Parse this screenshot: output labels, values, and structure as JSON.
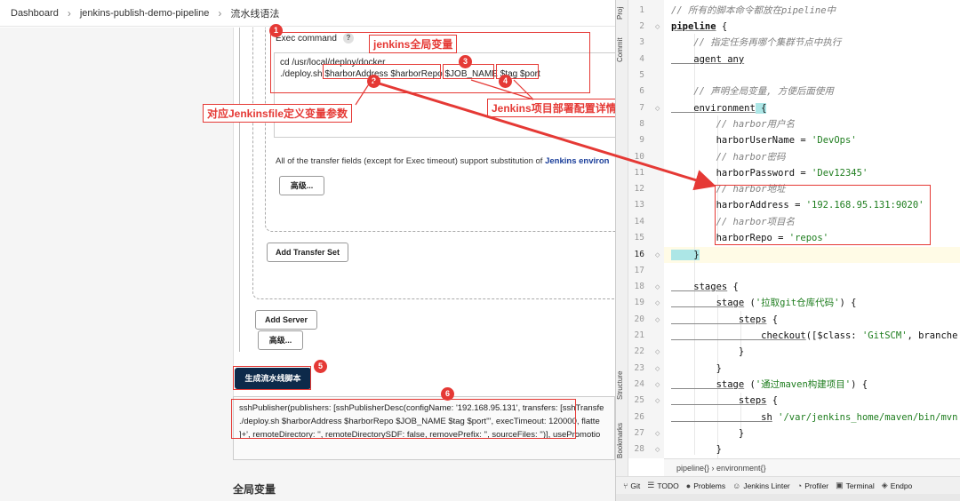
{
  "breadcrumb": [
    "Dashboard",
    "jenkins-publish-demo-pipeline",
    "流水线语法"
  ],
  "exec_label": "Exec command",
  "help_icon": "?",
  "exec_command_lines": [
    "cd /usr/local/deploy/docker",
    "./deploy.sh $harborAddress $harborRepo $JOB_NAME $tag $port"
  ],
  "transfer_note": "All of the transfer fields (except for Exec timeout) support substitution of",
  "transfer_note_link": "Jenkins environ",
  "buttons": {
    "advanced_1": "高级...",
    "add_transfer_set": "Add Transfer Set",
    "add_server": "Add Server",
    "advanced_2": "高级...",
    "generate": "生成流水线脚本"
  },
  "output_lines": [
    "sshPublisher(publishers: [sshPublisherDesc(configName: '192.168.95.131', transfers: [sshTransfe",
    "./deploy.sh $harborAddress $harborRepo $JOB_NAME $tag $port''', execTimeout: 120000, flatte",
    "]+', remoteDirectory: '', remoteDirectorySDF: false, removePrefix: '', sourceFiles: '')], usePromotio"
  ],
  "section_heading": "全局变量",
  "annotations": {
    "jenkins_global_vars": "jenkins全局变量",
    "jenkinsfile_vars": "对应Jenkinsfile定义变量参数",
    "job_config_params": "Jenkins项目部署配置详情配置的参数",
    "numbers": [
      "1",
      "2",
      "3",
      "4",
      "5",
      "6"
    ]
  },
  "ide": {
    "side_tabs_top": [
      "Proj",
      "Commit"
    ],
    "side_tabs_bottom": [
      "Structure",
      "Bookmarks"
    ],
    "line_numbers": [
      "1",
      "2",
      "3",
      "4",
      "5",
      "6",
      "7",
      "8",
      "9",
      "10",
      "11",
      "12",
      "13",
      "14",
      "15",
      "16",
      "17",
      "18",
      "19",
      "20",
      "21",
      "22",
      "23",
      "24",
      "25",
      "26",
      "27",
      "28"
    ],
    "code": {
      "l1": "// 所有的脚本命令都放在pipeline中",
      "l2_kw": "pipeline",
      "l2_rest": " {",
      "l3": "    // 指定任务再哪个集群节点中执行",
      "l4_kw": "    agent any",
      "l6": "    // 声明全局变量, 方便后面使用",
      "l7_kw": "    environment",
      "l7_rest": " {",
      "l8": "        // harbor用户名",
      "l9_key": "        harborUserName = ",
      "l9_val": "'DevOps'",
      "l10": "        // harbor密码",
      "l11_key": "        harborPassword = ",
      "l11_val": "'Dev12345'",
      "l12": "        // harbor地址",
      "l13_key": "        harborAddress = ",
      "l13_val": "'192.168.95.131:9020'",
      "l14": "        // harbor项目名",
      "l15_key": "        harborRepo = ",
      "l15_val": "'repos'",
      "l16": "    }",
      "l18_kw": "    stages",
      "l18_rest": " {",
      "l19_kw": "        stage",
      "l19_rest": " (",
      "l19_str": "'拉取git仓库代码'",
      "l19_end": ") {",
      "l20_kw": "            steps",
      "l20_rest": " {",
      "l21_kw": "                checkout",
      "l21_rest": "([$class: ",
      "l21_str": "'GitSCM'",
      "l21_end": ", branche",
      "l22": "            }",
      "l23": "        }",
      "l24_kw": "        stage",
      "l24_rest": " (",
      "l24_str": "'通过maven构建项目'",
      "l24_end": ") {",
      "l25_kw": "            steps",
      "l25_rest": " {",
      "l26_kw": "                sh",
      "l26_str": " '/var/jenkins_home/maven/bin/mvn",
      "l27": "            }",
      "l28": "        }"
    },
    "editor_breadcrumb": "pipeline{}  ›  environment{}",
    "bottom_tools": [
      {
        "icon": "git-icon",
        "glyph": "⑂",
        "label": "Git"
      },
      {
        "icon": "todo-icon",
        "glyph": "☰",
        "label": "TODO"
      },
      {
        "icon": "problems-icon",
        "glyph": "●",
        "label": "Problems"
      },
      {
        "icon": "jenkins-linter-icon",
        "glyph": "☺",
        "label": "Jenkins Linter"
      },
      {
        "icon": "profiler-icon",
        "glyph": "◔",
        "label": "Profiler"
      },
      {
        "icon": "terminal-icon",
        "glyph": "▣",
        "label": "Terminal"
      },
      {
        "icon": "endpoints-icon",
        "glyph": "◈",
        "label": "Endpo"
      }
    ]
  },
  "colors": {
    "annotation_red": "#e53935",
    "generate_button": "#0d2a4a",
    "string_green": "#1e7d1e",
    "comment_gray": "#808080"
  }
}
